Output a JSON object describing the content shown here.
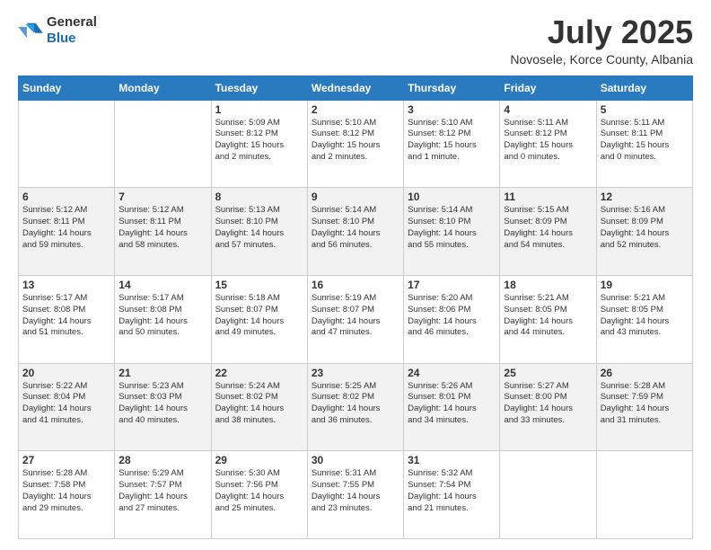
{
  "logo": {
    "general": "General",
    "blue": "Blue"
  },
  "header": {
    "month": "July 2025",
    "location": "Novosele, Korce County, Albania"
  },
  "days_of_week": [
    "Sunday",
    "Monday",
    "Tuesday",
    "Wednesday",
    "Thursday",
    "Friday",
    "Saturday"
  ],
  "weeks": [
    [
      {
        "day": "",
        "info": ""
      },
      {
        "day": "",
        "info": ""
      },
      {
        "day": "1",
        "info": "Sunrise: 5:09 AM\nSunset: 8:12 PM\nDaylight: 15 hours\nand 2 minutes."
      },
      {
        "day": "2",
        "info": "Sunrise: 5:10 AM\nSunset: 8:12 PM\nDaylight: 15 hours\nand 2 minutes."
      },
      {
        "day": "3",
        "info": "Sunrise: 5:10 AM\nSunset: 8:12 PM\nDaylight: 15 hours\nand 1 minute."
      },
      {
        "day": "4",
        "info": "Sunrise: 5:11 AM\nSunset: 8:12 PM\nDaylight: 15 hours\nand 0 minutes."
      },
      {
        "day": "5",
        "info": "Sunrise: 5:11 AM\nSunset: 8:11 PM\nDaylight: 15 hours\nand 0 minutes."
      }
    ],
    [
      {
        "day": "6",
        "info": "Sunrise: 5:12 AM\nSunset: 8:11 PM\nDaylight: 14 hours\nand 59 minutes."
      },
      {
        "day": "7",
        "info": "Sunrise: 5:12 AM\nSunset: 8:11 PM\nDaylight: 14 hours\nand 58 minutes."
      },
      {
        "day": "8",
        "info": "Sunrise: 5:13 AM\nSunset: 8:10 PM\nDaylight: 14 hours\nand 57 minutes."
      },
      {
        "day": "9",
        "info": "Sunrise: 5:14 AM\nSunset: 8:10 PM\nDaylight: 14 hours\nand 56 minutes."
      },
      {
        "day": "10",
        "info": "Sunrise: 5:14 AM\nSunset: 8:10 PM\nDaylight: 14 hours\nand 55 minutes."
      },
      {
        "day": "11",
        "info": "Sunrise: 5:15 AM\nSunset: 8:09 PM\nDaylight: 14 hours\nand 54 minutes."
      },
      {
        "day": "12",
        "info": "Sunrise: 5:16 AM\nSunset: 8:09 PM\nDaylight: 14 hours\nand 52 minutes."
      }
    ],
    [
      {
        "day": "13",
        "info": "Sunrise: 5:17 AM\nSunset: 8:08 PM\nDaylight: 14 hours\nand 51 minutes."
      },
      {
        "day": "14",
        "info": "Sunrise: 5:17 AM\nSunset: 8:08 PM\nDaylight: 14 hours\nand 50 minutes."
      },
      {
        "day": "15",
        "info": "Sunrise: 5:18 AM\nSunset: 8:07 PM\nDaylight: 14 hours\nand 49 minutes."
      },
      {
        "day": "16",
        "info": "Sunrise: 5:19 AM\nSunset: 8:07 PM\nDaylight: 14 hours\nand 47 minutes."
      },
      {
        "day": "17",
        "info": "Sunrise: 5:20 AM\nSunset: 8:06 PM\nDaylight: 14 hours\nand 46 minutes."
      },
      {
        "day": "18",
        "info": "Sunrise: 5:21 AM\nSunset: 8:05 PM\nDaylight: 14 hours\nand 44 minutes."
      },
      {
        "day": "19",
        "info": "Sunrise: 5:21 AM\nSunset: 8:05 PM\nDaylight: 14 hours\nand 43 minutes."
      }
    ],
    [
      {
        "day": "20",
        "info": "Sunrise: 5:22 AM\nSunset: 8:04 PM\nDaylight: 14 hours\nand 41 minutes."
      },
      {
        "day": "21",
        "info": "Sunrise: 5:23 AM\nSunset: 8:03 PM\nDaylight: 14 hours\nand 40 minutes."
      },
      {
        "day": "22",
        "info": "Sunrise: 5:24 AM\nSunset: 8:02 PM\nDaylight: 14 hours\nand 38 minutes."
      },
      {
        "day": "23",
        "info": "Sunrise: 5:25 AM\nSunset: 8:02 PM\nDaylight: 14 hours\nand 36 minutes."
      },
      {
        "day": "24",
        "info": "Sunrise: 5:26 AM\nSunset: 8:01 PM\nDaylight: 14 hours\nand 34 minutes."
      },
      {
        "day": "25",
        "info": "Sunrise: 5:27 AM\nSunset: 8:00 PM\nDaylight: 14 hours\nand 33 minutes."
      },
      {
        "day": "26",
        "info": "Sunrise: 5:28 AM\nSunset: 7:59 PM\nDaylight: 14 hours\nand 31 minutes."
      }
    ],
    [
      {
        "day": "27",
        "info": "Sunrise: 5:28 AM\nSunset: 7:58 PM\nDaylight: 14 hours\nand 29 minutes."
      },
      {
        "day": "28",
        "info": "Sunrise: 5:29 AM\nSunset: 7:57 PM\nDaylight: 14 hours\nand 27 minutes."
      },
      {
        "day": "29",
        "info": "Sunrise: 5:30 AM\nSunset: 7:56 PM\nDaylight: 14 hours\nand 25 minutes."
      },
      {
        "day": "30",
        "info": "Sunrise: 5:31 AM\nSunset: 7:55 PM\nDaylight: 14 hours\nand 23 minutes."
      },
      {
        "day": "31",
        "info": "Sunrise: 5:32 AM\nSunset: 7:54 PM\nDaylight: 14 hours\nand 21 minutes."
      },
      {
        "day": "",
        "info": ""
      },
      {
        "day": "",
        "info": ""
      }
    ]
  ]
}
